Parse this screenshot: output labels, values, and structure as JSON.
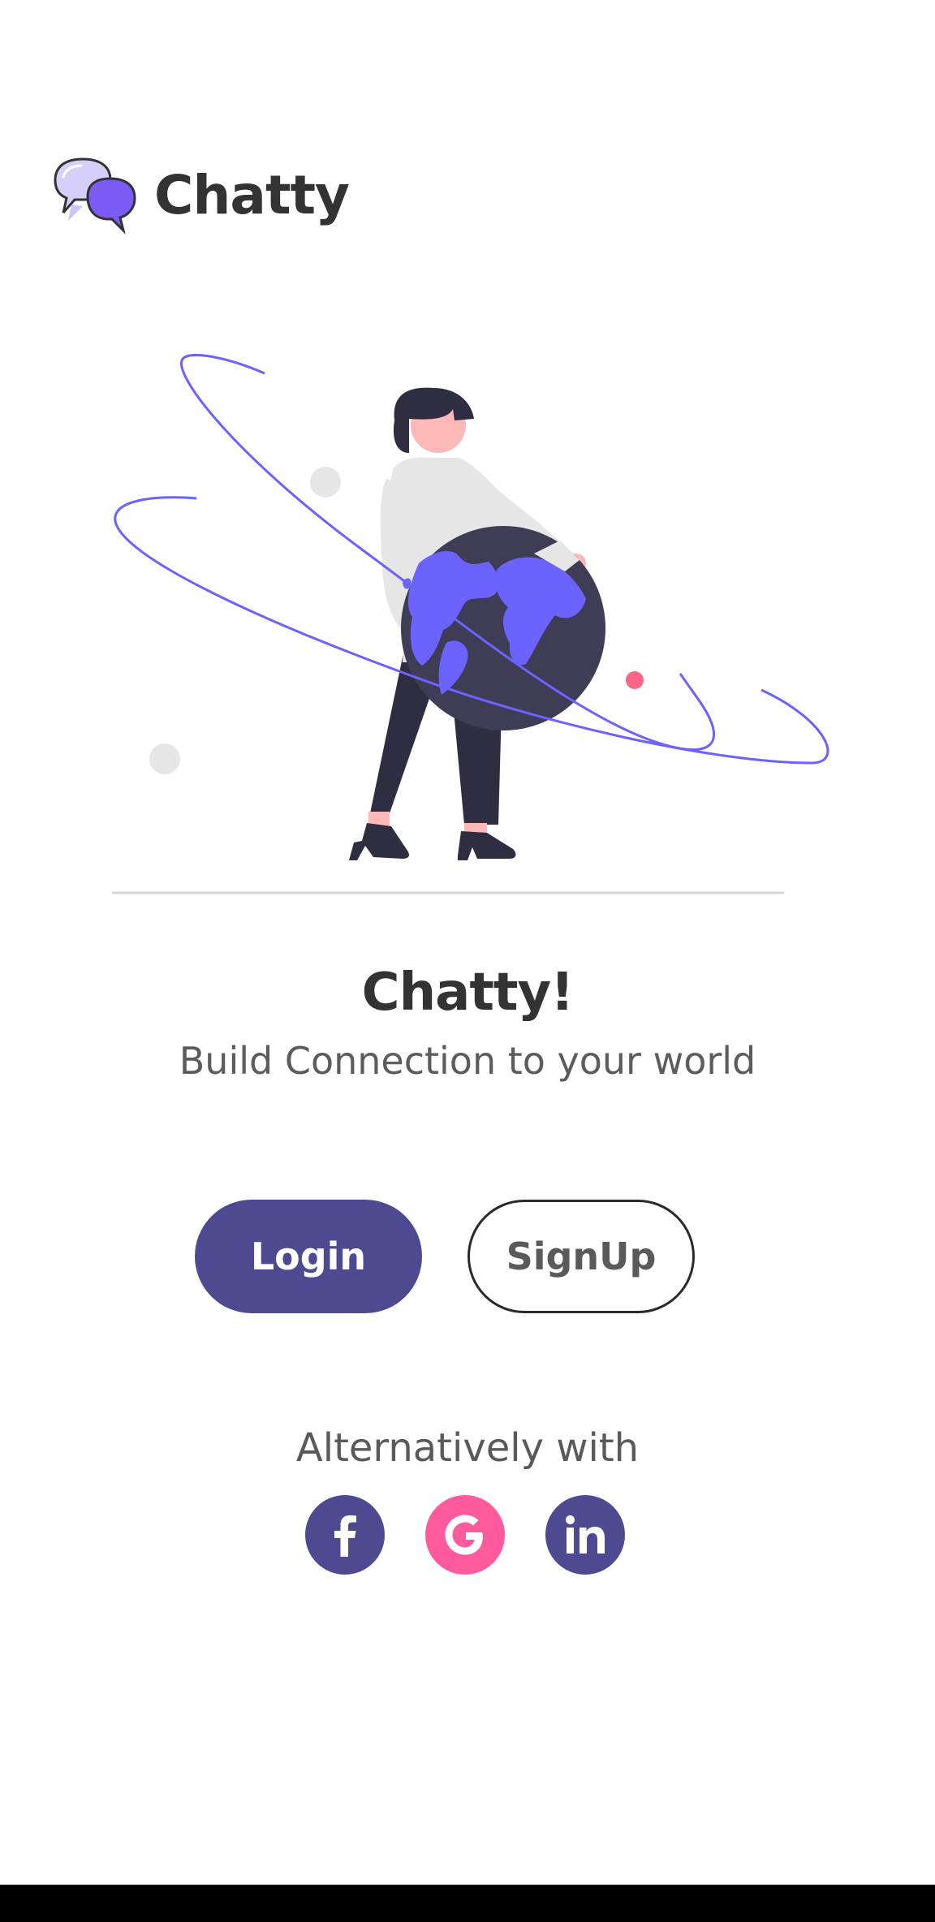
{
  "app": {
    "name": "Chatty",
    "logo_icon": "chat-bubbles-icon"
  },
  "hero": {
    "illustration": "person-holding-globe-illustration"
  },
  "welcome": {
    "title": "Chatty!",
    "subtitle": "Build Connection to your world"
  },
  "actions": {
    "login_label": "Login",
    "signup_label": "SignUp"
  },
  "social": {
    "label": "Alternatively with",
    "providers": [
      {
        "name": "facebook",
        "icon": "facebook-icon",
        "color": "#4e4a92"
      },
      {
        "name": "google",
        "icon": "google-icon",
        "color": "#ff5a9d"
      },
      {
        "name": "linkedin",
        "icon": "linkedin-icon",
        "color": "#4e4a92"
      }
    ]
  },
  "colors": {
    "primary": "#4e4a92",
    "accent": "#6c63ff",
    "pink": "#ff5a9d",
    "text_dark": "#333333",
    "text_muted": "#5c5c5c"
  }
}
